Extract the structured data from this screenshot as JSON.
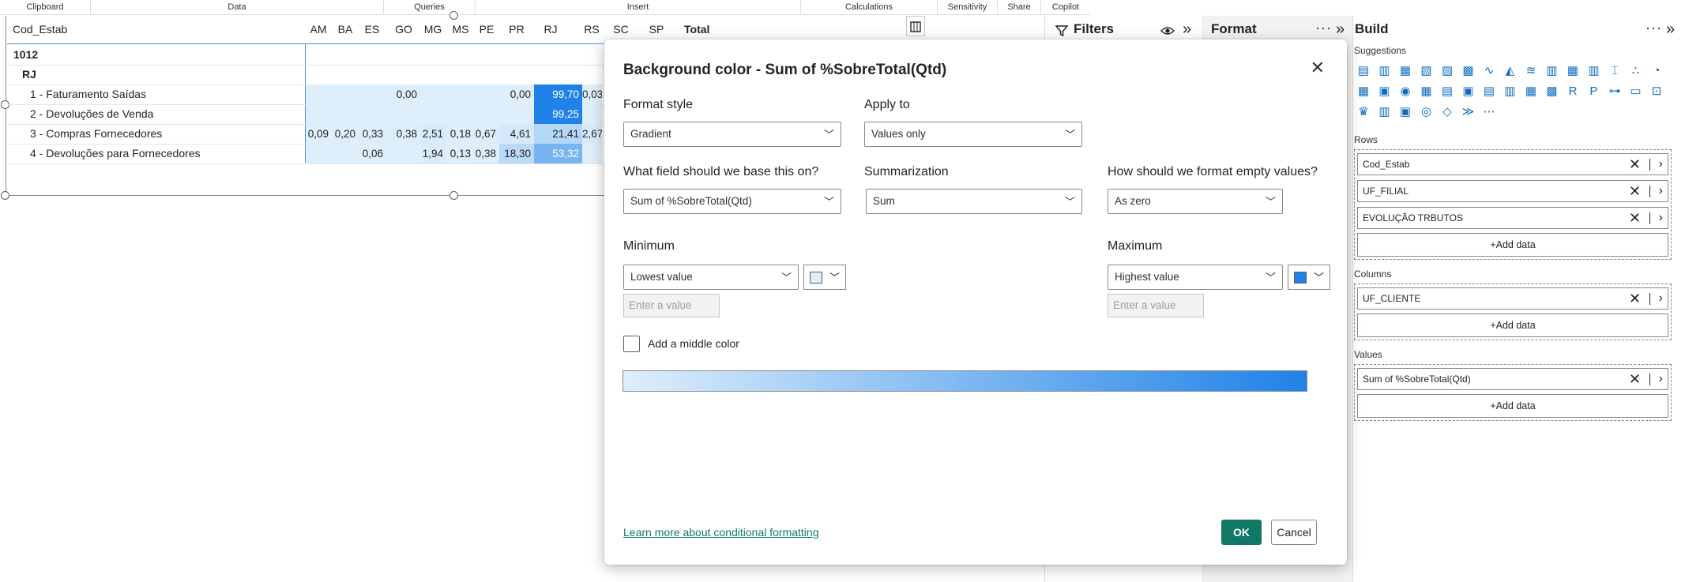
{
  "ribbon": {
    "groups": [
      "Clipboard",
      "Data",
      "Queries",
      "Insert",
      "Calculations",
      "Sensitivity",
      "Share",
      "Copilot"
    ]
  },
  "matrix": {
    "row_header": "Cod_Estab",
    "columns": [
      "AM",
      "BA",
      "ES",
      "GO",
      "MG",
      "MS",
      "PE",
      "PR",
      "RJ",
      "RS",
      "SC",
      "SP"
    ],
    "total_header": "Total",
    "level1": "1012",
    "level2": "RJ",
    "rows": [
      {
        "label": "1 - Faturamento Saídas",
        "values": [
          "",
          "",
          "",
          "0,00",
          "",
          "",
          "",
          "0,00",
          "99,70",
          "0,03",
          "",
          ""
        ]
      },
      {
        "label": "2 - Devoluções de Venda",
        "values": [
          "",
          "",
          "",
          "",
          "",
          "",
          "",
          "",
          "99,25",
          "",
          "",
          ""
        ]
      },
      {
        "label": "3 - Compras Fornecedores",
        "values": [
          "0,09",
          "0,20",
          "0,33",
          "0,38",
          "2,51",
          "0,18",
          "0,67",
          "4,61",
          "21,41",
          "2,67",
          "",
          ""
        ]
      },
      {
        "label": "4 - Devoluções para Fornecedores",
        "values": [
          "",
          "",
          "0,06",
          "",
          "1,94",
          "0,13",
          "0,38",
          "18,30",
          "53,32",
          "",
          "",
          ""
        ]
      }
    ],
    "scale_min_color": "#deeefb",
    "scale_max_color": "#1f82e8"
  },
  "filters": {
    "title": "Filters"
  },
  "format": {
    "title": "Format"
  },
  "build": {
    "title": "Build",
    "suggestions_label": "Suggestions",
    "rows_label": "Rows",
    "rows": [
      "Cod_Estab",
      "UF_FILIAL",
      "EVOLUÇÃO TRBUTOS"
    ],
    "columns_label": "Columns",
    "columns": [
      "UF_CLIENTE"
    ],
    "values_label": "Values",
    "values": [
      "Sum of %SobreTotal(Qtd)"
    ],
    "add_data": "+Add data"
  },
  "dialog": {
    "title": "Background color - Sum of %SobreTotal(Qtd)",
    "format_style_label": "Format style",
    "format_style_value": "Gradient",
    "apply_to_label": "Apply to",
    "apply_to_value": "Values only",
    "base_field_label": "What field should we base this on?",
    "base_field_value": "Sum of %SobreTotal(Qtd)",
    "summarization_label": "Summarization",
    "summarization_value": "Sum",
    "empty_values_label": "How should we format empty values?",
    "empty_values_value": "As zero",
    "minimum_label": "Minimum",
    "minimum_value": "Lowest value",
    "minimum_placeholder": "Enter a value",
    "minimum_color": "#deeefb",
    "maximum_label": "Maximum",
    "maximum_value": "Highest value",
    "maximum_placeholder": "Enter a value",
    "maximum_color": "#1f82e8",
    "middle_color_label": "Add a middle color",
    "middle_color_checked": false,
    "learn_more": "Learn more about conditional formatting",
    "ok": "OK",
    "cancel": "Cancel"
  }
}
